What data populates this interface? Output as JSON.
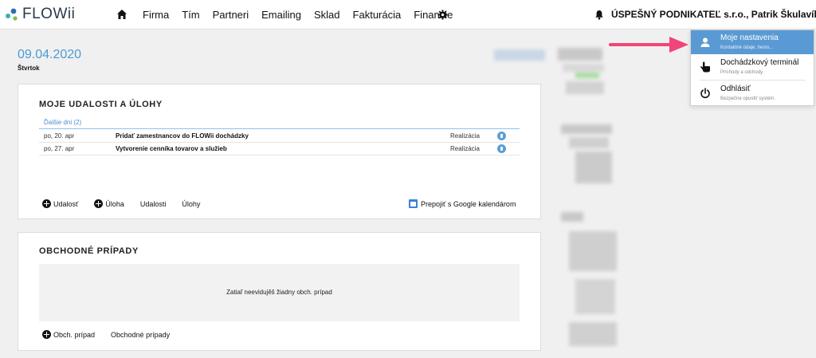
{
  "app": {
    "logo_text": "FLOWii",
    "brand_color": "#4a9ad4"
  },
  "nav": {
    "items": [
      "Firma",
      "Tím",
      "Partneri",
      "Emailing",
      "Sklad",
      "Fakturácia",
      "Financie"
    ],
    "home_icon": "home-icon",
    "settings_icon": "gear-icon"
  },
  "header": {
    "company_user": "ÚSPEŠNÝ PODNIKATEĽ s.r.o., Patrik Škulavík",
    "notification_icon": "bell-icon"
  },
  "date": {
    "value": "09.04.2020",
    "weekday": "Štvrtok"
  },
  "events_card": {
    "title": "MOJE UDALOSTI A ÚLOHY",
    "group_label": "Ďalšie dni (2)",
    "rows": [
      {
        "date": "po, 20. apr",
        "title": "Pridať zamestnancov do FLOWii dochádzky",
        "status": "Realizácia"
      },
      {
        "date": "po, 27. apr",
        "title": "Vytvorenie cenníka tovarov a služieb",
        "status": "Realizácia"
      }
    ],
    "actions": {
      "add_event": "Udalosť",
      "add_task": "Úloha",
      "events_link": "Udalosti",
      "tasks_link": "Úlohy"
    },
    "google_link": "Prepojiť s Google kalendárom"
  },
  "cases_card": {
    "title": "OBCHODNÉ PRÍPADY",
    "empty_text": "Zatiaľ neevidujěš žiadny obch. prípad",
    "actions": {
      "add_case": "Obch. prípad",
      "cases_link": "Obchodné prípady"
    }
  },
  "dropdown": {
    "items": [
      {
        "label": "Moje nastavenia",
        "sub": "Kontaktné údaje, heslo...",
        "icon": "user-icon",
        "active": true
      },
      {
        "label": "Dochádzkový terminál",
        "sub": "Príchody a odchody.",
        "icon": "hand-pointer-icon",
        "active": false
      },
      {
        "label": "Odhlásiť",
        "sub": "Bezpečne opustiť systém.",
        "icon": "power-icon",
        "active": false
      }
    ],
    "highlight_color": "#5a9ad4",
    "arrow_color": "#f0457a"
  }
}
